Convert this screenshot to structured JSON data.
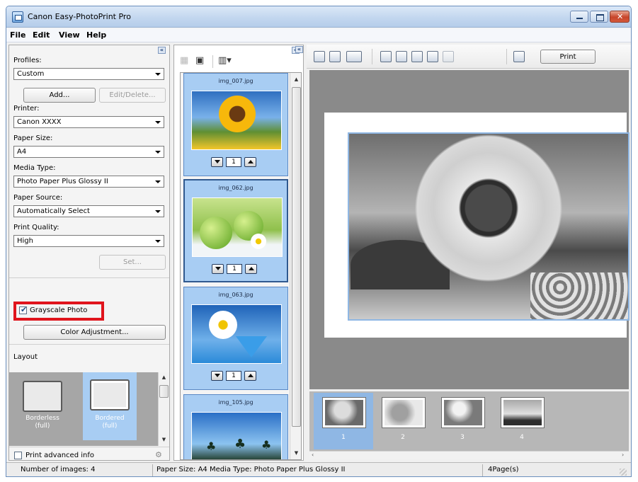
{
  "window": {
    "title": "Canon Easy-PhotoPrint Pro"
  },
  "menu": [
    "File",
    "Edit",
    "View",
    "Help"
  ],
  "settings": {
    "profiles_label": "Profiles:",
    "profiles_value": "Custom",
    "add_button": "Add...",
    "edit_delete_button": "Edit/Delete...",
    "printer_label": "Printer:",
    "printer_value": "Canon XXXX",
    "paper_size_label": "Paper Size:",
    "paper_size_value": "A4",
    "media_type_label": "Media Type:",
    "media_type_value": "Photo Paper Plus Glossy II",
    "paper_source_label": "Paper Source:",
    "paper_source_value": "Automatically Select",
    "print_quality_label": "Print Quality:",
    "print_quality_value": "High",
    "set_button": "Set...",
    "grayscale_label": "Grayscale Photo",
    "grayscale_checked": true,
    "color_adjustment_button": "Color Adjustment...",
    "layout_label": "Layout",
    "layouts": [
      {
        "label": "Borderless (full)",
        "line1": "Borderless",
        "line2": "(full)"
      },
      {
        "label": "Bordered (full)",
        "line1": "Bordered",
        "line2": "(full)"
      }
    ],
    "print_advanced_label": "Print advanced info",
    "print_advanced_checked": false
  },
  "images": [
    {
      "name": "img_007.jpg",
      "copies": "1"
    },
    {
      "name": "img_062.jpg",
      "copies": "1"
    },
    {
      "name": "img_063.jpg",
      "copies": "1"
    },
    {
      "name": "img_105.jpg",
      "copies": ""
    }
  ],
  "toolbar": {
    "print_button": "Print"
  },
  "strip": [
    "1",
    "2",
    "3",
    "4"
  ],
  "status": {
    "count": "Number of images: 4",
    "paper": "Paper Size: A4 Media Type: Photo Paper Plus Glossy II",
    "pages": "4Page(s)"
  },
  "colors": {
    "highlight": "#e0141c",
    "selection": "#a8cdf3",
    "preview_bg": "#8a8a8a"
  }
}
